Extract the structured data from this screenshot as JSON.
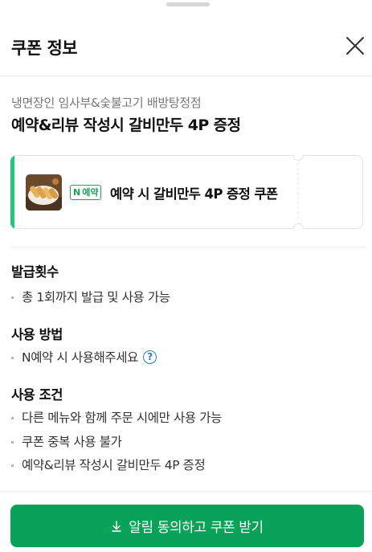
{
  "header": {
    "title": "쿠폰 정보",
    "close_icon": "close-icon"
  },
  "store": {
    "name": "냉면장인 임사부&숯불고기 배방탕정점"
  },
  "event": {
    "title": "예약&리뷰 작성시 갈비만두 4P 증정"
  },
  "coupon": {
    "badge_letter": "N",
    "badge_text": "예약",
    "name": "예약 시 갈비만두 4P 증정 쿠폰",
    "accent_color": "#1ec97a",
    "badge_color": "#1aa35a"
  },
  "sections": {
    "issue": {
      "title": "발급횟수",
      "items": [
        "총 1회까지 발급 및 사용 가능"
      ]
    },
    "usage": {
      "title": "사용 방법",
      "items": [
        "N예약 시 사용해주세요"
      ],
      "help_symbol": "?"
    },
    "conditions": {
      "title": "사용 조건",
      "items": [
        "다른 메뉴와 함께 주문 시에만 사용 가능",
        "쿠폰 중복 사용 불가",
        "예약&리뷰 작성시 갈비만두 4P 증정"
      ]
    }
  },
  "cta": {
    "icon": "download-icon",
    "label": "알림 동의하고 쿠폰 받기",
    "color": "#0aa158"
  }
}
